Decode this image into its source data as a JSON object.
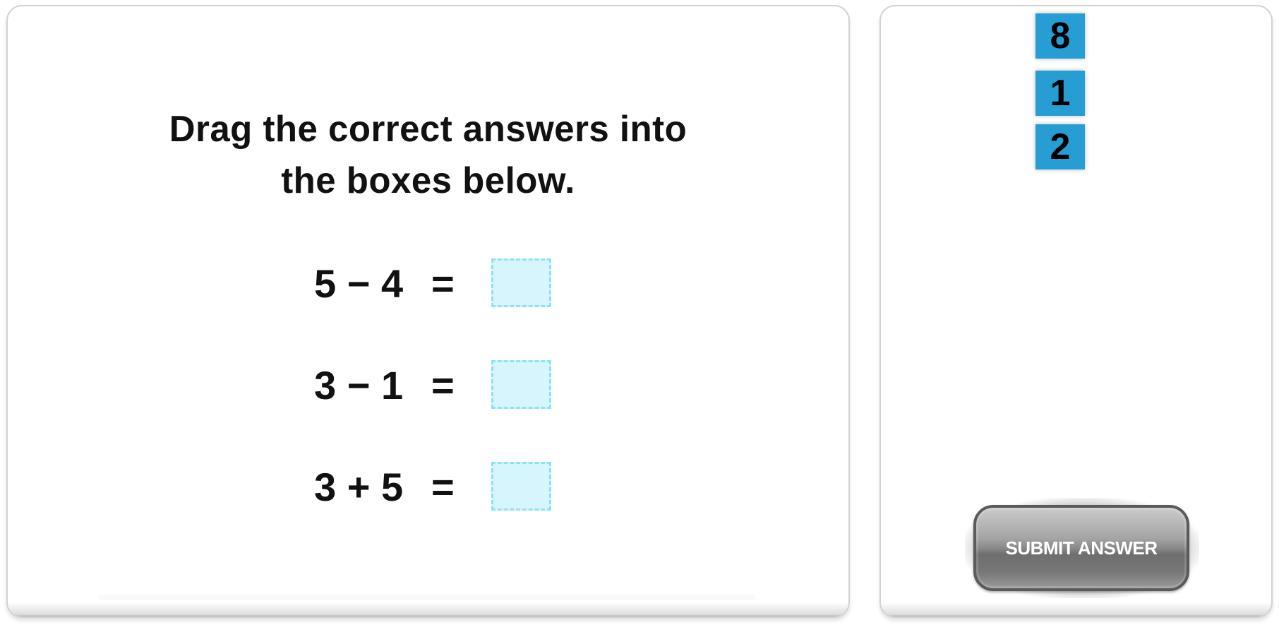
{
  "instructions": {
    "line1": "Drag the correct answers into",
    "line2": "the boxes below."
  },
  "equations": [
    {
      "expression": "5 − 4",
      "equals": "=",
      "answer": ""
    },
    {
      "expression": "3 − 1",
      "equals": "=",
      "answer": ""
    },
    {
      "expression": "3 + 5",
      "equals": "=",
      "answer": ""
    }
  ],
  "answer_tiles": [
    {
      "value": "8"
    },
    {
      "value": "1"
    },
    {
      "value": "2"
    }
  ],
  "submit": {
    "label": "SUBMIT ANSWER"
  },
  "colors": {
    "tile_background": "#269ed3",
    "drop_box_fill": "#d6f5fc",
    "drop_box_border": "#8ee2f8",
    "button": "#6e6e6e"
  }
}
